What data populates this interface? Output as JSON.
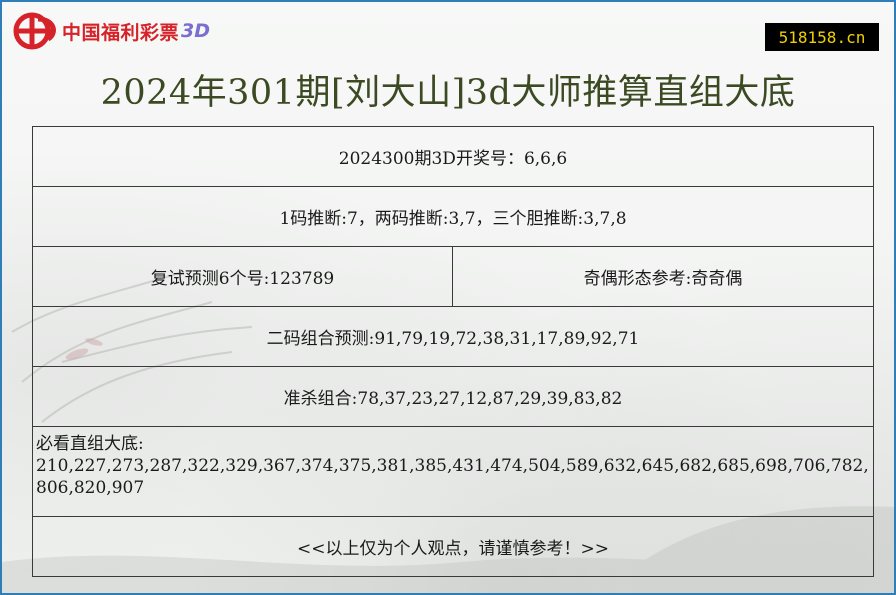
{
  "logo": {
    "brand": "中国福利彩票",
    "suffix": "3D"
  },
  "site": {
    "badge": "518158.cn"
  },
  "title": "2024年301期[刘大山]3d大师推算直组大底",
  "rows": {
    "draw": "2024300期3D开奖号：6,6,6",
    "predict": "1码推断:7，两码推断:3,7，三个胆推断:3,7,8",
    "retry": "复试预测6个号:123789",
    "parity": "奇偶形态参考:奇奇偶",
    "pairs": "二码组合预测:91,79,19,72,38,31,17,89,92,71",
    "kill": "准杀组合:78,37,23,27,12,87,29,39,83,82",
    "base_label": "必看直组大底:",
    "base_values": "210,227,273,287,322,329,367,374,375,381,385,431,474,504,589,632,645,682,685,698,706,782,806,820,907",
    "footer": "<<以上仅为个人观点，请谨慎参考！>>"
  },
  "colors": {
    "border_accent": "#2e7fb8",
    "title": "#3b4a22",
    "badge_bg": "#000000",
    "badge_text": "#f0d000",
    "logo_red": "#d6232a"
  }
}
